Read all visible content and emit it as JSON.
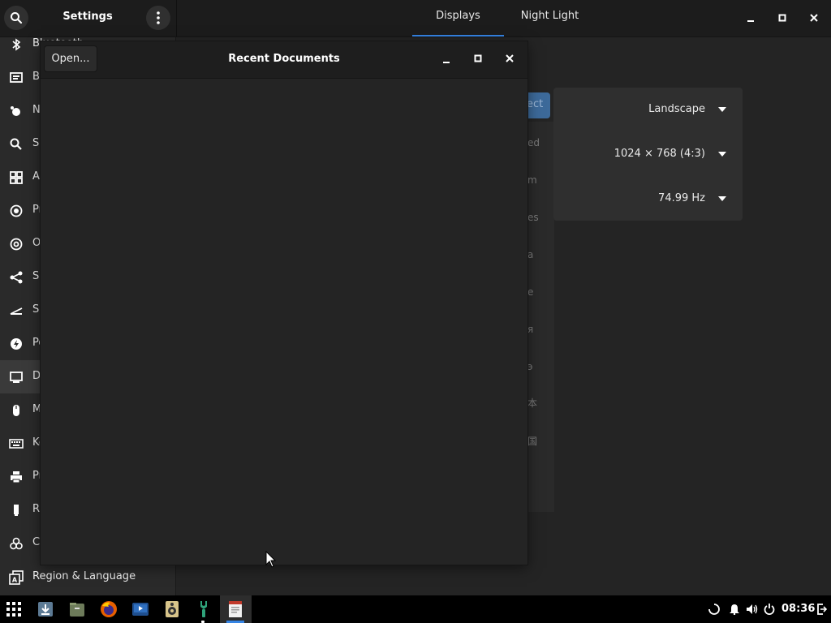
{
  "settings": {
    "title": "Settings",
    "tabs": [
      {
        "label": "Displays",
        "active": true
      },
      {
        "label": "Night Light",
        "active": false
      }
    ]
  },
  "sidebar": {
    "items": [
      {
        "label": "Bluetooth",
        "icon": "bluetooth-icon"
      },
      {
        "label": "Ba",
        "icon": "background-icon"
      },
      {
        "label": "N",
        "icon": "notifications-icon"
      },
      {
        "label": "Se",
        "icon": "search-icon"
      },
      {
        "label": "Ap",
        "icon": "applications-icon"
      },
      {
        "label": "Pr",
        "icon": "privacy-icon"
      },
      {
        "label": "O",
        "icon": "online-accounts-icon"
      },
      {
        "label": "Sh",
        "icon": "sharing-icon"
      },
      {
        "label": "So",
        "icon": "sound-icon"
      },
      {
        "label": "Po",
        "icon": "power-icon"
      },
      {
        "label": "D",
        "icon": "displays-icon",
        "active": true
      },
      {
        "label": "M",
        "icon": "mouse-icon"
      },
      {
        "label": "Ke",
        "icon": "keyboard-icon"
      },
      {
        "label": "Pr",
        "icon": "printers-icon"
      },
      {
        "label": "Re",
        "icon": "removable-media-icon"
      },
      {
        "label": "Co",
        "icon": "color-icon"
      },
      {
        "label": "Region & Language",
        "icon": "region-language-icon"
      }
    ]
  },
  "displays": {
    "orientation": "Landscape",
    "resolution": "1024 × 768 (4:3)",
    "refresh_rate": "74.99 Hz",
    "partial_button": "ect",
    "partial_list": [
      "ed",
      "m",
      "es",
      "a",
      "e",
      "я",
      "э",
      "本",
      "国"
    ]
  },
  "dialog": {
    "title": "Recent Documents",
    "open_label": "Open..."
  },
  "taskbar": {
    "clock": "08:36",
    "apps": [
      "apps-grid-icon",
      "downloads-icon",
      "files-icon",
      "firefox-icon",
      "video-player-icon",
      "rhythmbox-icon",
      "settings-app-icon",
      "text-editor-icon"
    ]
  },
  "colors": {
    "accent": "#3584e4",
    "background": "#242424",
    "header": "#1c1c1c",
    "taskbar": "#000000"
  }
}
